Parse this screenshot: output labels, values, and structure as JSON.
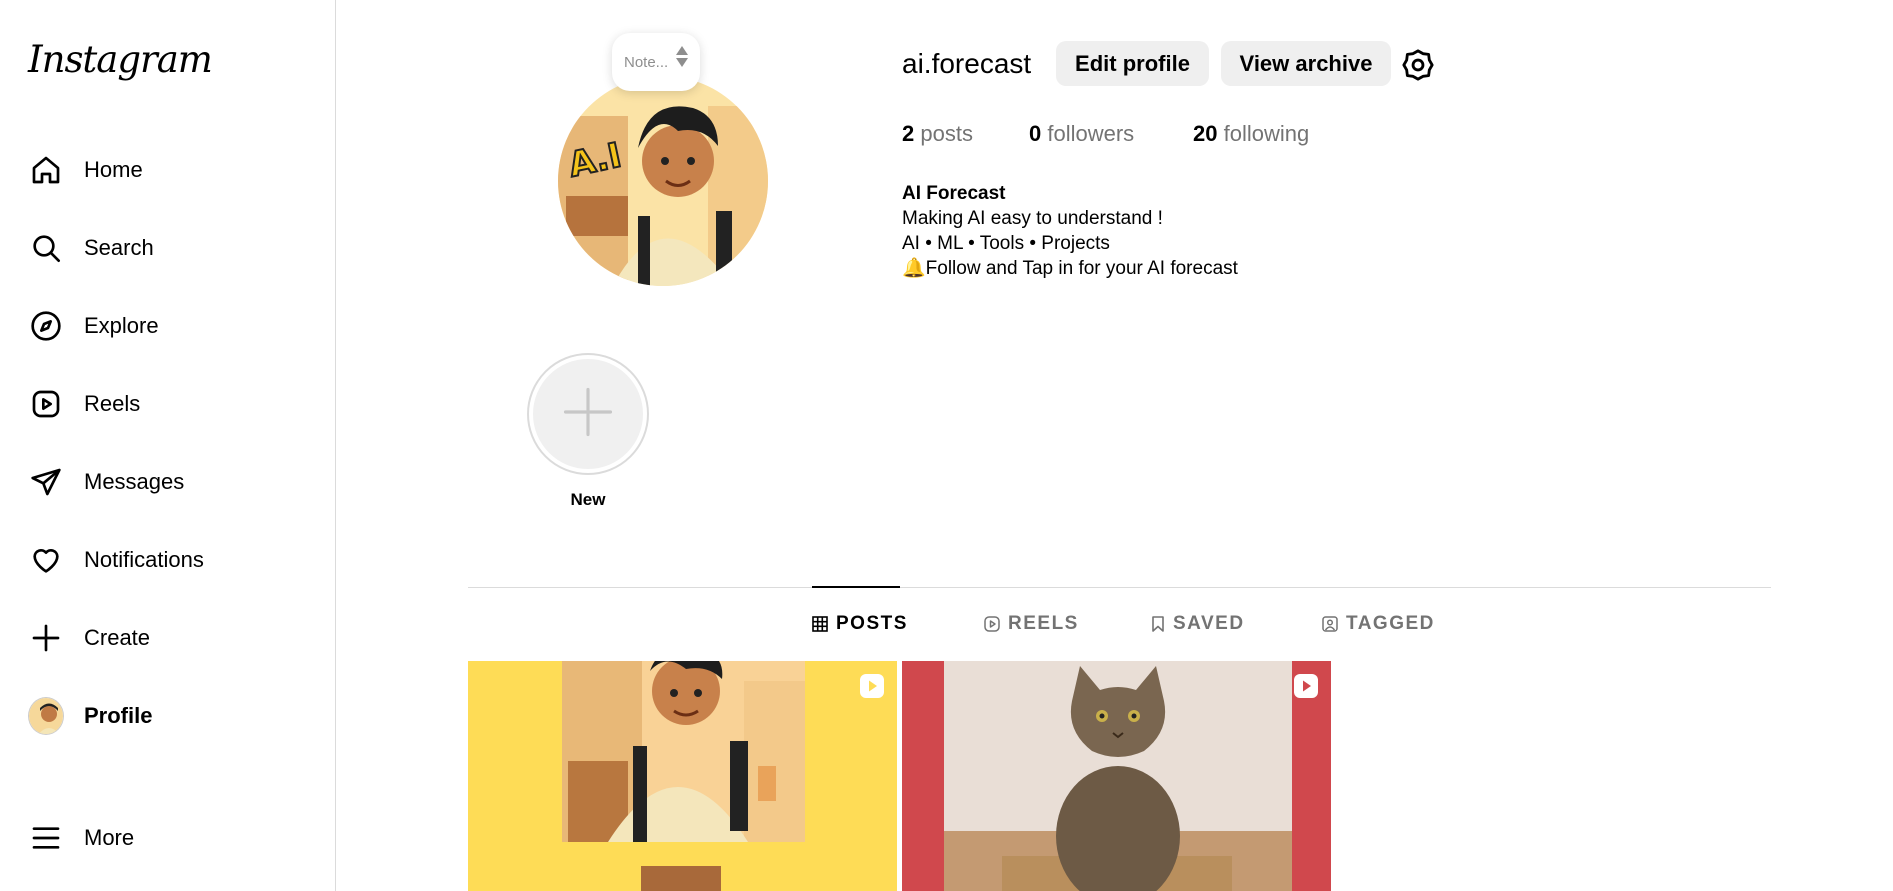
{
  "sidebar": {
    "logo": "Instagram",
    "items": [
      {
        "label": "Home",
        "icon": "home-icon"
      },
      {
        "label": "Search",
        "icon": "search-icon"
      },
      {
        "label": "Explore",
        "icon": "compass-icon"
      },
      {
        "label": "Reels",
        "icon": "reels-icon"
      },
      {
        "label": "Messages",
        "icon": "send-icon"
      },
      {
        "label": "Notifications",
        "icon": "heart-icon"
      },
      {
        "label": "Create",
        "icon": "plus-icon"
      },
      {
        "label": "Profile",
        "icon": "avatar"
      },
      {
        "label": "More",
        "icon": "menu-icon"
      }
    ]
  },
  "profile": {
    "note_placeholder": "Note...",
    "username": "ai.forecast",
    "edit_label": "Edit profile",
    "archive_label": "View archive",
    "stats": {
      "posts_count": "2",
      "posts_label": "posts",
      "followers_count": "0",
      "followers_label": "followers",
      "following_count": "20",
      "following_label": "following"
    },
    "bio": {
      "name": "AI Forecast",
      "line1": "Making AI easy to understand !",
      "line2": "AI • ML • Tools • Projects",
      "line3": "🔔Follow and Tap in for your AI forecast"
    }
  },
  "highlights": {
    "new_label": "New"
  },
  "tabs": [
    {
      "label": "POSTS",
      "icon": "grid-icon",
      "active": true
    },
    {
      "label": "REELS",
      "icon": "reels-icon",
      "active": false
    },
    {
      "label": "SAVED",
      "icon": "bookmark-icon",
      "active": false
    },
    {
      "label": "TAGGED",
      "icon": "tag-user-icon",
      "active": false
    }
  ],
  "posts": [
    {
      "type": "reel",
      "background": "#fedc56"
    },
    {
      "type": "reel",
      "background": "#d0484d"
    }
  ]
}
